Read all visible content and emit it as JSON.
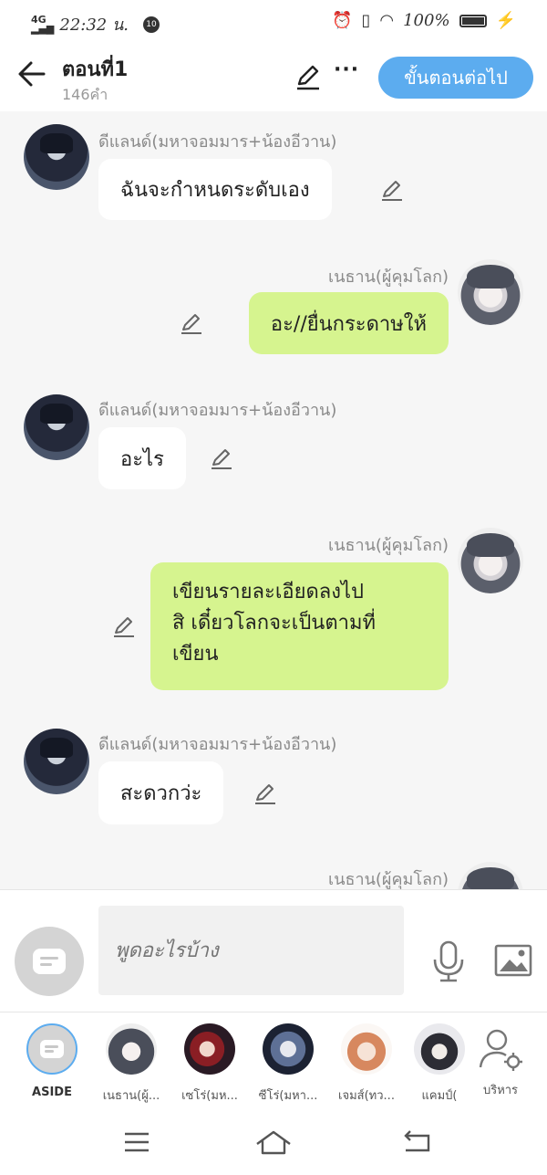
{
  "status_bar": {
    "network": "4G",
    "time": "22:32 น.",
    "notification_count": "10",
    "battery": "100%"
  },
  "header": {
    "title": "ตอนที่1",
    "word_count": "146คำ",
    "next_step_label": "ขั้นตอนต่อไป",
    "more_label": "···"
  },
  "messages": [
    {
      "speaker": "ดีแลนด์(มหาจอมมาร+น้องอีวาน)",
      "side": "left",
      "lines": [
        "ฉันจะกำหนดระดับเอง"
      ]
    },
    {
      "speaker": "เนธาน(ผู้คุมโลก)",
      "side": "right",
      "lines": [
        "อะ//ยื่นกระดาษให้"
      ]
    },
    {
      "speaker": "ดีแลนด์(มหาจอมมาร+น้องอีวาน)",
      "side": "left",
      "lines": [
        "อะไร"
      ]
    },
    {
      "speaker": "เนธาน(ผู้คุมโลก)",
      "side": "right",
      "lines": [
        "เขียนรายละเอียดลงไป",
        "สิ เดี๋ยวโลกจะเป็นตามที่",
        "เขียน"
      ]
    },
    {
      "speaker": "ดีแลนด์(มหาจอมมาร+น้องอีวาน)",
      "side": "left",
      "lines": [
        "สะดวกว่ะ"
      ]
    },
    {
      "speaker": "เนธาน(ผู้คุมโลก)",
      "side": "right",
      "lines": []
    }
  ],
  "composer": {
    "placeholder": "พูดอะไรบ้าง"
  },
  "characters": [
    {
      "label": "ASIDE"
    },
    {
      "label": "เนธาน(ผู้..."
    },
    {
      "label": "เซโร่(มห..."
    },
    {
      "label": "ซีโร่(มหา..."
    },
    {
      "label": "เจมส์(ทว..."
    },
    {
      "label": "แคมป์("
    },
    {
      "label": "บริหาร"
    }
  ],
  "colors": {
    "accent": "#5cacef",
    "outgoing_bubble": "#d6f48f",
    "incoming_bubble": "#ffffff",
    "background": "#f6f6f6"
  }
}
